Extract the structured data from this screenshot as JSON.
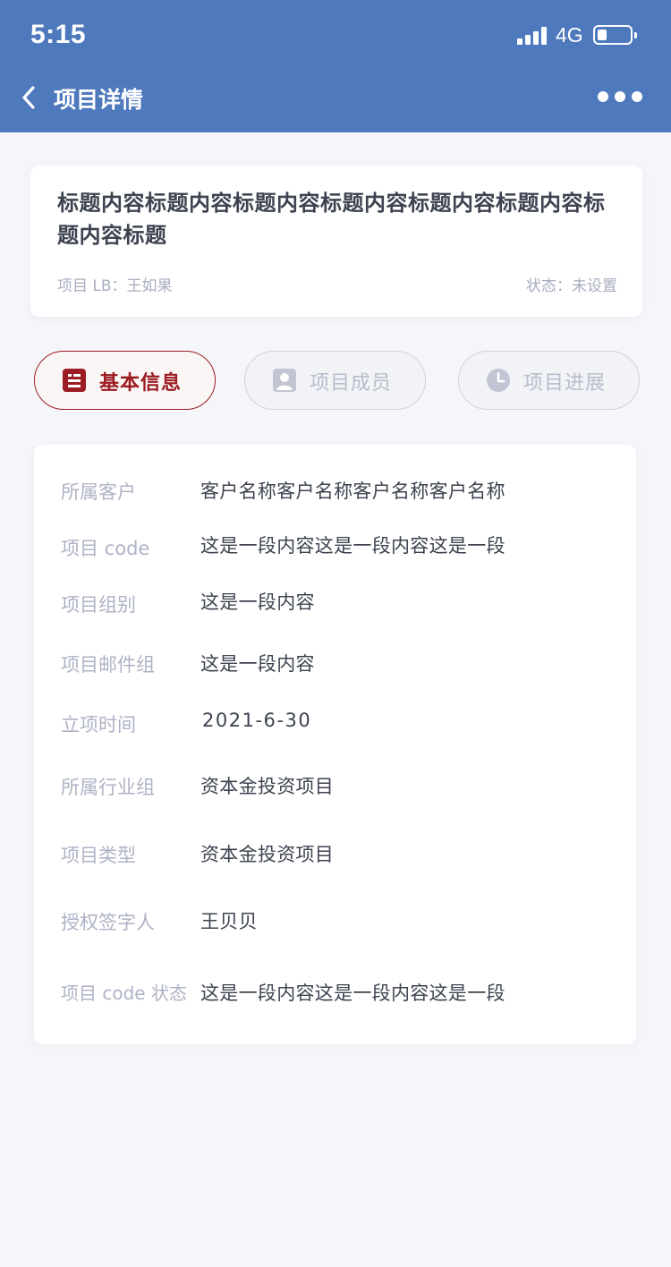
{
  "status_bar": {
    "time": "5:15",
    "network": "4G",
    "signal_bars": 4,
    "battery_level": 0.2
  },
  "nav": {
    "title": "项目详情",
    "back_icon": "chevron-left-icon",
    "more_icon": "more-horizontal-icon"
  },
  "summary": {
    "title": "标题内容标题内容标题内容标题内容标题内容标题内容标题内容标题",
    "lb": "项目 LB：王如果",
    "status": "状态：未设置"
  },
  "tabs": [
    {
      "label": "基本信息",
      "icon": "document-list-icon",
      "active": true
    },
    {
      "label": "项目成员",
      "icon": "user-icon",
      "active": false
    },
    {
      "label": "项目进展",
      "icon": "clock-icon",
      "active": false
    }
  ],
  "info": [
    {
      "label": "所属客户",
      "value": "客户名称客户名称客户名称客户名称"
    },
    {
      "label": "项目 code",
      "value": "这是一段内容这是一段内容这是一段"
    },
    {
      "label": "项目组别",
      "value": "这是一段内容"
    },
    {
      "label": "项目邮件组",
      "value": "这是一段内容"
    },
    {
      "label": "立项时间",
      "value": "2021-6-30"
    },
    {
      "label": "所属行业组",
      "value": "资本金投资项目"
    },
    {
      "label": "项目类型",
      "value": "资本金投资项目"
    },
    {
      "label": "授权签字人",
      "value": "王贝贝"
    },
    {
      "label": "项目 code 状态",
      "value": "这是一段内容这是一段内容这是一段"
    }
  ],
  "colors": {
    "header": "#4f79bd",
    "accent": "#9b1c22",
    "background": "#f5f6fa"
  }
}
